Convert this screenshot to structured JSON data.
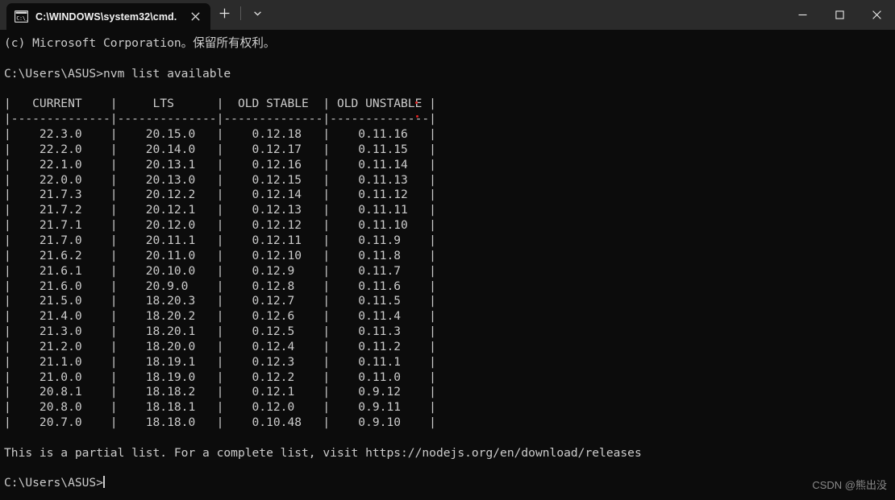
{
  "window": {
    "tab": {
      "title": "C:\\WINDOWS\\system32\\cmd.",
      "icon": "cmd-console-icon",
      "close_label": "✕"
    },
    "new_tab_label": "+",
    "tab_menu_label": "˅",
    "controls": {
      "minimize_label": "—",
      "maximize_label": "□",
      "close_label": "✕"
    }
  },
  "colors": {
    "titlebar_bg": "#2b2b2b",
    "terminal_bg": "#0c0c0c",
    "terminal_fg": "#cccccc",
    "artifact_red": "#e02020",
    "watermark_fg": "#8a8a8a"
  },
  "terminal": {
    "copyright_line": "(c) Microsoft Corporation。保留所有权利。",
    "blank_1": "",
    "prompt_command_line": "C:\\Users\\ASUS>nvm list available",
    "blank_2": "",
    "table": {
      "header": "|   CURRENT    |     LTS      |  OLD STABLE  | OLD UNSTABLE |",
      "separator": "|--------------|--------------|--------------|--------------|",
      "columns": [
        "CURRENT",
        "LTS",
        "OLD STABLE",
        "OLD UNSTABLE"
      ],
      "rows": [
        [
          "22.3.0",
          "20.15.0",
          "0.12.18",
          "0.11.16"
        ],
        [
          "22.2.0",
          "20.14.0",
          "0.12.17",
          "0.11.15"
        ],
        [
          "22.1.0",
          "20.13.1",
          "0.12.16",
          "0.11.14"
        ],
        [
          "22.0.0",
          "20.13.0",
          "0.12.15",
          "0.11.13"
        ],
        [
          "21.7.3",
          "20.12.2",
          "0.12.14",
          "0.11.12"
        ],
        [
          "21.7.2",
          "20.12.1",
          "0.12.13",
          "0.11.11"
        ],
        [
          "21.7.1",
          "20.12.0",
          "0.12.12",
          "0.11.10"
        ],
        [
          "21.7.0",
          "20.11.1",
          "0.12.11",
          "0.11.9"
        ],
        [
          "21.6.2",
          "20.11.0",
          "0.12.10",
          "0.11.8"
        ],
        [
          "21.6.1",
          "20.10.0",
          "0.12.9",
          "0.11.7"
        ],
        [
          "21.6.0",
          "20.9.0",
          "0.12.8",
          "0.11.6"
        ],
        [
          "21.5.0",
          "18.20.3",
          "0.12.7",
          "0.11.5"
        ],
        [
          "21.4.0",
          "18.20.2",
          "0.12.6",
          "0.11.4"
        ],
        [
          "21.3.0",
          "18.20.1",
          "0.12.5",
          "0.11.3"
        ],
        [
          "21.2.0",
          "18.20.0",
          "0.12.4",
          "0.11.2"
        ],
        [
          "21.1.0",
          "18.19.1",
          "0.12.3",
          "0.11.1"
        ],
        [
          "21.0.0",
          "18.19.0",
          "0.12.2",
          "0.11.0"
        ],
        [
          "20.8.1",
          "18.18.2",
          "0.12.1",
          "0.9.12"
        ],
        [
          "20.8.0",
          "18.18.1",
          "0.12.0",
          "0.9.11"
        ],
        [
          "20.7.0",
          "18.18.0",
          "0.10.48",
          "0.9.10"
        ]
      ]
    },
    "blank_3": "",
    "footer_note": "This is a partial list. For a complete list, visit https://nodejs.org/en/download/releases",
    "blank_4": "",
    "final_prompt": "C:\\Users\\ASUS>"
  },
  "watermark": {
    "text": "CSDN @熊出没"
  }
}
